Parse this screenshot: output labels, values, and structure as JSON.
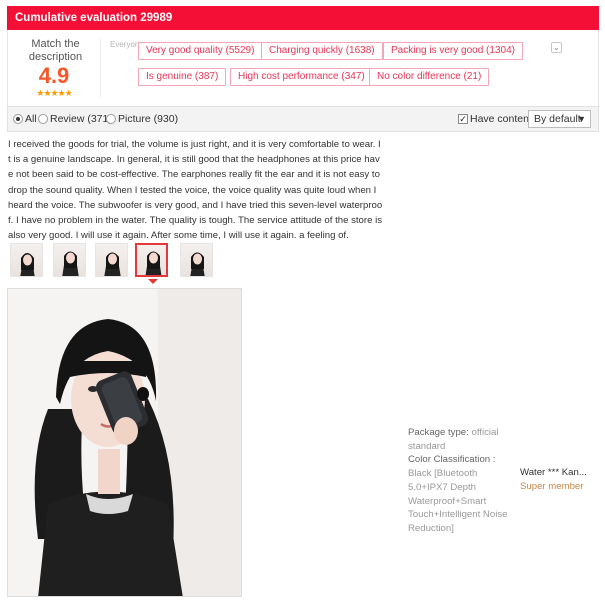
{
  "header": {
    "title": "Cumulative evaluation 29989"
  },
  "score": {
    "label": "Match the description",
    "value": "4.9",
    "stars": "★★★★★"
  },
  "everyone_wrote": "Everyone wrote",
  "tags": [
    {
      "label": "Very good quality (5529)"
    },
    {
      "label": "Charging quickly (1638)"
    },
    {
      "label": "Packing is very good (1304)"
    },
    {
      "label": "Is genuine (387)"
    },
    {
      "label": "High cost performance (347)"
    },
    {
      "label": "No color difference (21)"
    }
  ],
  "filters": {
    "all": "All",
    "review": "Review (371)",
    "picture": "Picture (930)",
    "have_content": "Have content",
    "sort": "By default"
  },
  "review": {
    "text": "I received the goods for trial, the volume is just right, and it is very comfortable to wear. It is a genuine landscape. In general, it is still good that the headphones at this price have not been said to be cost-effective. The earphones really fit the ear and it is not easy to drop the sound quality. When I tested the voice, the voice quality was quite loud when I heard the voice. The subwoofer is very good, and I have tried this seven-level waterproof. I have no problem in the water. The quality is tough. The service attitude of the store is also very good. I will use it again. After some time, I will use it again. a feeling of."
  },
  "sku": {
    "package_key": "Package type:",
    "package_val": "official standard",
    "color_key": "Color Classification :",
    "color_val": "Black [Bluetooth 5.0+IPX7 Depth Waterproof+Smart Touch+Intelligent Noise Reduction]"
  },
  "user": {
    "name": "Water *** Kan...",
    "level": "Super member"
  },
  "colors": {
    "accent": "#f40f37",
    "score": "#f5572a",
    "tag_text": "#e73656",
    "member": "#c8874a"
  }
}
